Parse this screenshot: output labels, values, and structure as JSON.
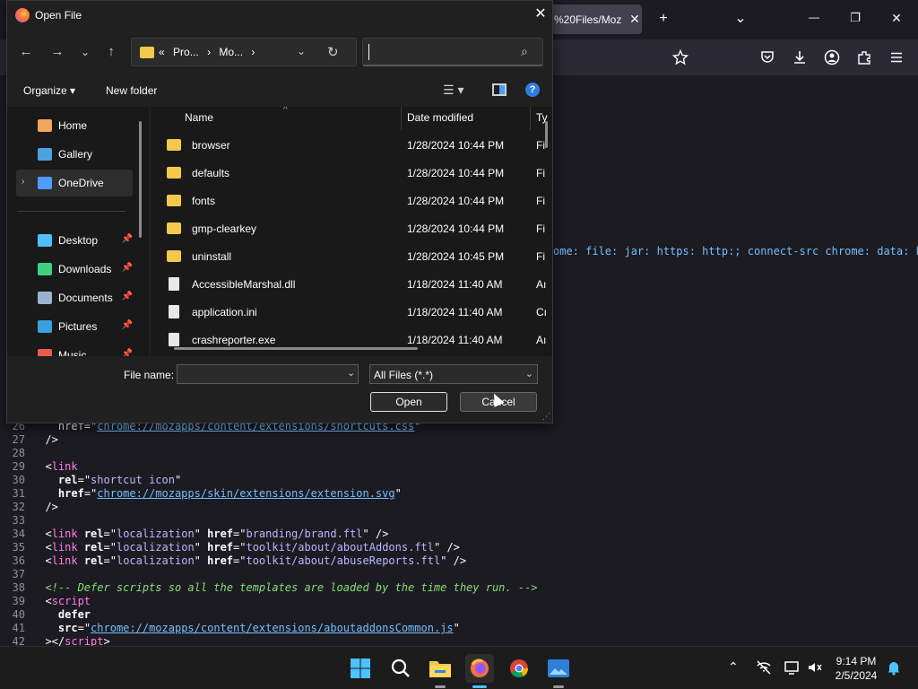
{
  "browser": {
    "tab_title": "%20Files/Moz",
    "tab_close": "✕",
    "new_tab": "+",
    "list_tabs": "⌄",
    "win_min": "—",
    "win_max": "❐",
    "win_close": "✕",
    "icons": [
      "star-icon",
      "pocket-icon",
      "download-icon",
      "account-icon",
      "extensions-icon",
      "menu-icon"
    ],
    "csp_text": "ome: file: jar: https: http:; connect-src chrome: data: ht"
  },
  "code": [
    {
      "n": "26",
      "parts": [
        [
          "plain",
          "    href=\""
        ],
        [
          "link",
          "chrome://mozapps/content/extensions/shortcuts.css"
        ],
        [
          "plain",
          "\""
        ]
      ]
    },
    {
      "n": "27",
      "parts": [
        [
          "plain",
          "  />"
        ]
      ]
    },
    {
      "n": "28",
      "parts": []
    },
    {
      "n": "29",
      "parts": [
        [
          "plain",
          "  <"
        ],
        [
          "tag",
          "link"
        ]
      ]
    },
    {
      "n": "30",
      "parts": [
        [
          "plain",
          "    "
        ],
        [
          "attr",
          "rel"
        ],
        [
          "plain",
          "=\""
        ],
        [
          "str",
          "shortcut icon"
        ],
        [
          "plain",
          "\""
        ]
      ]
    },
    {
      "n": "31",
      "parts": [
        [
          "plain",
          "    "
        ],
        [
          "attr",
          "href"
        ],
        [
          "plain",
          "=\""
        ],
        [
          "link",
          "chrome://mozapps/skin/extensions/extension.svg"
        ],
        [
          "plain",
          "\""
        ]
      ]
    },
    {
      "n": "32",
      "parts": [
        [
          "plain",
          "  />"
        ]
      ]
    },
    {
      "n": "33",
      "parts": []
    },
    {
      "n": "34",
      "parts": [
        [
          "plain",
          "  <"
        ],
        [
          "tag",
          "link"
        ],
        [
          "plain",
          " "
        ],
        [
          "attr",
          "rel"
        ],
        [
          "plain",
          "=\""
        ],
        [
          "str",
          "localization"
        ],
        [
          "plain",
          "\" "
        ],
        [
          "attr",
          "href"
        ],
        [
          "plain",
          "=\""
        ],
        [
          "str",
          "branding/brand.ftl"
        ],
        [
          "plain",
          "\" />"
        ]
      ]
    },
    {
      "n": "35",
      "parts": [
        [
          "plain",
          "  <"
        ],
        [
          "tag",
          "link"
        ],
        [
          "plain",
          " "
        ],
        [
          "attr",
          "rel"
        ],
        [
          "plain",
          "=\""
        ],
        [
          "str",
          "localization"
        ],
        [
          "plain",
          "\" "
        ],
        [
          "attr",
          "href"
        ],
        [
          "plain",
          "=\""
        ],
        [
          "str",
          "toolkit/about/aboutAddons.ftl"
        ],
        [
          "plain",
          "\" />"
        ]
      ]
    },
    {
      "n": "36",
      "parts": [
        [
          "plain",
          "  <"
        ],
        [
          "tag",
          "link"
        ],
        [
          "plain",
          " "
        ],
        [
          "attr",
          "rel"
        ],
        [
          "plain",
          "=\""
        ],
        [
          "str",
          "localization"
        ],
        [
          "plain",
          "\" "
        ],
        [
          "attr",
          "href"
        ],
        [
          "plain",
          "=\""
        ],
        [
          "str",
          "toolkit/about/abuseReports.ftl"
        ],
        [
          "plain",
          "\" />"
        ]
      ]
    },
    {
      "n": "37",
      "parts": []
    },
    {
      "n": "38",
      "parts": [
        [
          "plain",
          "  "
        ],
        [
          "cmt",
          "<!-- Defer scripts so all the templates are loaded by the time they run. -->"
        ]
      ]
    },
    {
      "n": "39",
      "parts": [
        [
          "plain",
          "  <"
        ],
        [
          "tag",
          "script"
        ]
      ]
    },
    {
      "n": "40",
      "parts": [
        [
          "plain",
          "    "
        ],
        [
          "attr",
          "defer"
        ]
      ]
    },
    {
      "n": "41",
      "parts": [
        [
          "plain",
          "    "
        ],
        [
          "attr",
          "src"
        ],
        [
          "plain",
          "=\""
        ],
        [
          "link",
          "chrome://mozapps/content/extensions/aboutaddonsCommon.js"
        ],
        [
          "plain",
          "\""
        ]
      ]
    },
    {
      "n": "42",
      "parts": [
        [
          "plain",
          "  ></"
        ],
        [
          "tag",
          "script"
        ],
        [
          "plain",
          ">"
        ]
      ]
    }
  ],
  "dialog": {
    "title": "Open File",
    "close": "✕",
    "nav": {
      "back": "←",
      "forward": "→",
      "recent": "⌄",
      "up": "↑"
    },
    "address": {
      "prefix": "«",
      "crumbs": [
        "Pro...",
        "›",
        "Mo...",
        "›"
      ],
      "dropdown": "⌄",
      "refresh": "↻"
    },
    "search": {
      "placeholder": "",
      "icon": "⌕"
    },
    "commands": {
      "organize": "Organize ▾",
      "new_folder": "New folder",
      "view": "☰ ▾",
      "help": "?"
    },
    "nav_items": [
      {
        "label": "Home",
        "icon": "home-icon",
        "color": "#f3a65b",
        "pinned": false
      },
      {
        "label": "Gallery",
        "icon": "gallery-icon",
        "color": "#4aa3df",
        "pinned": false
      },
      {
        "label": "OneDrive",
        "icon": "onedrive-icon",
        "color": "#4d9bff",
        "pinned": false,
        "expand": "›",
        "selected": true
      },
      {
        "label": "Desktop",
        "icon": "desktop-icon",
        "color": "#4ec0ff",
        "pinned": true
      },
      {
        "label": "Downloads",
        "icon": "downloads-icon",
        "color": "#3fd07f",
        "pinned": true
      },
      {
        "label": "Documents",
        "icon": "documents-icon",
        "color": "#9ab2d0",
        "pinned": true
      },
      {
        "label": "Pictures",
        "icon": "pictures-icon",
        "color": "#3aa0e0",
        "pinned": true
      },
      {
        "label": "Music",
        "icon": "music-icon",
        "color": "#e85c4a",
        "pinned": true
      }
    ],
    "pin_glyph": "📌",
    "columns": {
      "name": "Name",
      "date": "Date modified",
      "type": "Ty",
      "sort": "^"
    },
    "files": [
      {
        "name": "browser",
        "date": "1/28/2024 10:44 PM",
        "type": "Fi",
        "kind": "folder"
      },
      {
        "name": "defaults",
        "date": "1/28/2024 10:44 PM",
        "type": "Fi",
        "kind": "folder"
      },
      {
        "name": "fonts",
        "date": "1/28/2024 10:44 PM",
        "type": "Fi",
        "kind": "folder"
      },
      {
        "name": "gmp-clearkey",
        "date": "1/28/2024 10:44 PM",
        "type": "Fi",
        "kind": "folder"
      },
      {
        "name": "uninstall",
        "date": "1/28/2024 10:45 PM",
        "type": "Fi",
        "kind": "folder"
      },
      {
        "name": "AccessibleMarshal.dll",
        "date": "1/18/2024 11:40 AM",
        "type": "Aı",
        "kind": "file"
      },
      {
        "name": "application.ini",
        "date": "1/18/2024 11:40 AM",
        "type": "Cı",
        "kind": "file"
      },
      {
        "name": "crashreporter.exe",
        "date": "1/18/2024 11:40 AM",
        "type": "Aı",
        "kind": "file"
      }
    ],
    "filename_label": "File name:",
    "filename_value": "",
    "filename_dropdown": "⌄",
    "filter": "All Files (*.*)",
    "filter_dropdown": "⌄",
    "open": "Open",
    "cancel": "Cancel",
    "grip": "⋰"
  },
  "taskbar": {
    "apps": [
      {
        "name": "start-icon",
        "active": false
      },
      {
        "name": "search-icon",
        "active": false
      },
      {
        "name": "file-explorer-icon",
        "active": false,
        "running": true
      },
      {
        "name": "firefox-icon",
        "active": true,
        "running": true
      },
      {
        "name": "chrome-icon",
        "active": false
      },
      {
        "name": "photos-icon",
        "active": false,
        "running": true
      }
    ],
    "tray": {
      "chevron": "⌃",
      "time": "9:14 PM",
      "date": "2/5/2024"
    }
  }
}
